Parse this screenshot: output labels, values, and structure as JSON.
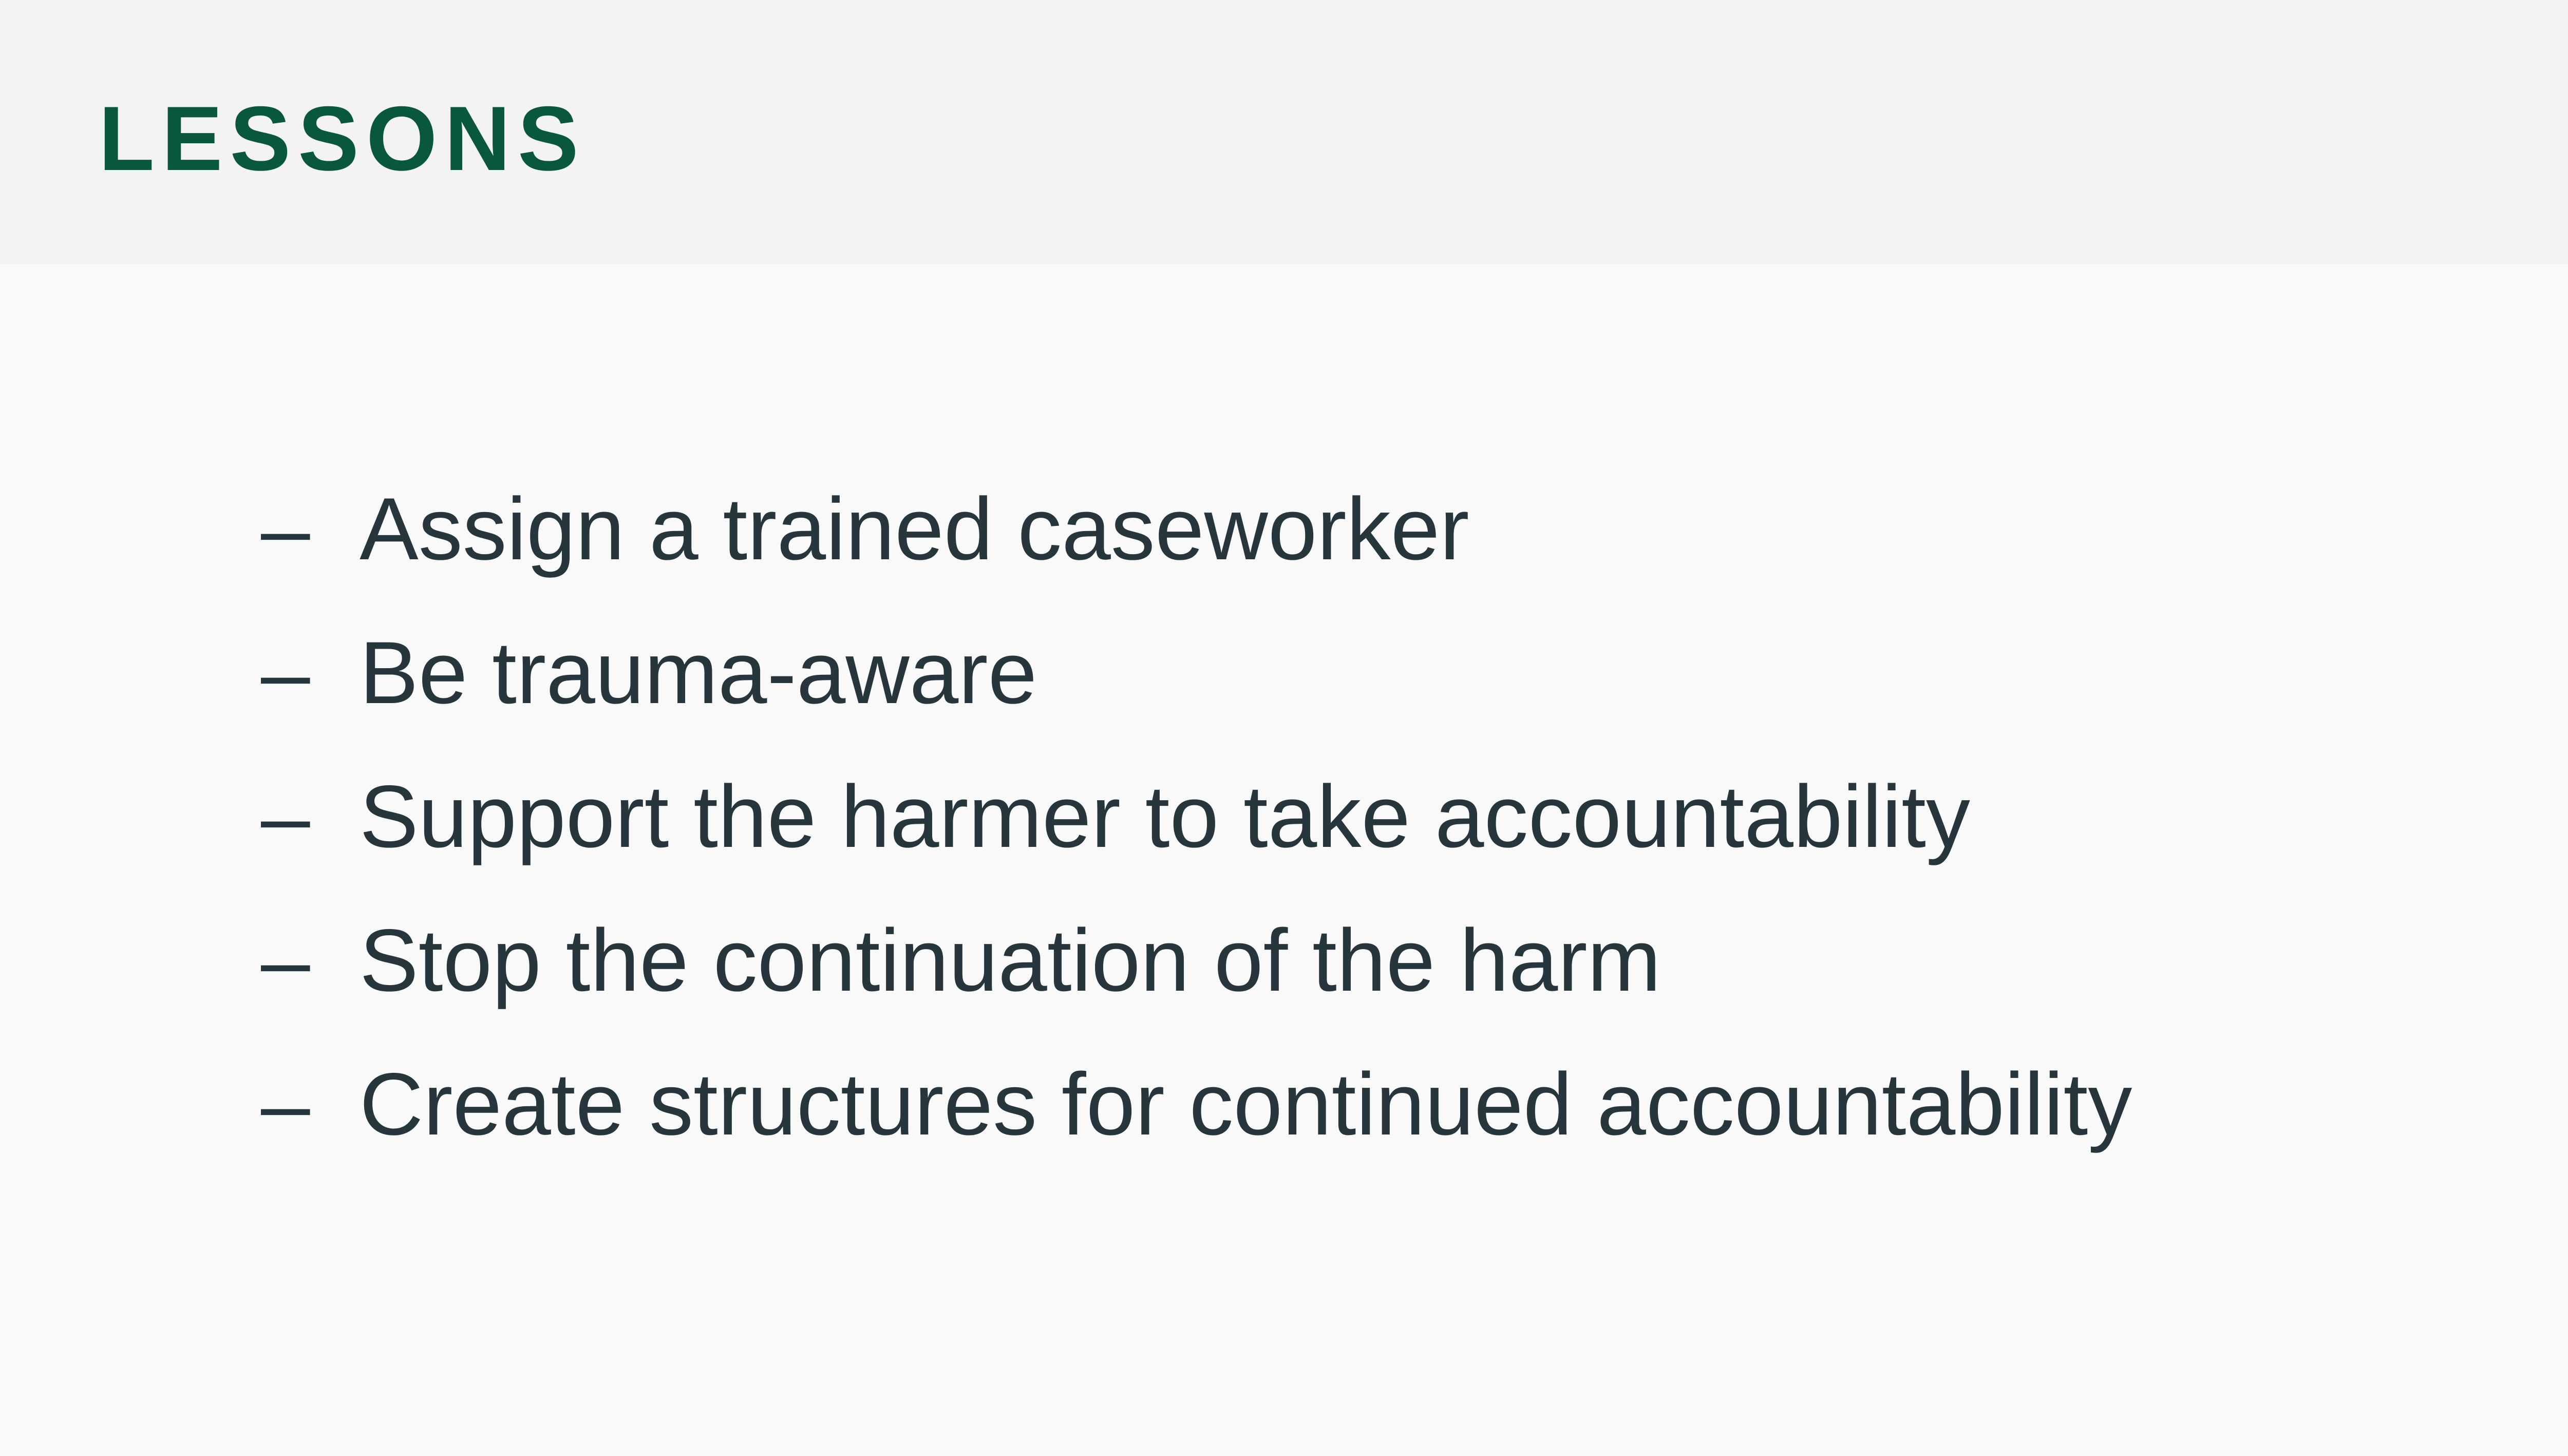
{
  "header": {
    "title": "LESSONS"
  },
  "bullets": {
    "marker": "–",
    "items": [
      "Assign a trained caseworker",
      "Be trauma-aware",
      "Support the harmer to take accountability",
      "Stop the continuation of the harm",
      "Create structures for continued accountability"
    ]
  },
  "colors": {
    "title": "#0a5740",
    "header_background": "#f3f3f3",
    "body_background": "#f9f9f9",
    "text": "#27363c"
  }
}
